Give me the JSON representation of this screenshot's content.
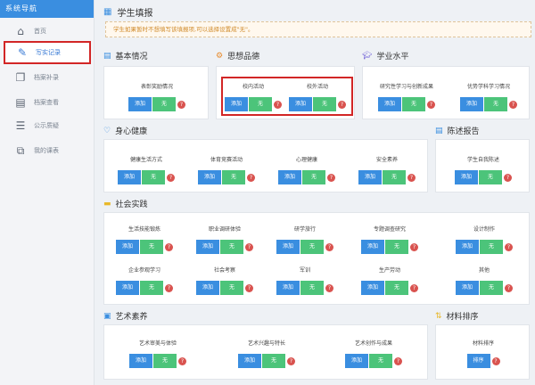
{
  "sidebar": {
    "header": "系统导航",
    "items": [
      {
        "label": "首页",
        "icon": "home-icon"
      },
      {
        "label": "写实记录",
        "icon": "edit-icon"
      },
      {
        "label": "档案补录",
        "icon": "copy-icon"
      },
      {
        "label": "档案查看",
        "icon": "archive-icon"
      },
      {
        "label": "公示质疑",
        "icon": "list-icon"
      },
      {
        "label": "我的课表",
        "icon": "schedule-icon"
      }
    ]
  },
  "page": {
    "title": "学生填报",
    "notice": "学生如果暂时不想填写该填报项,可以选择设置成\"无\"。"
  },
  "buttons": {
    "add": "添加",
    "none": "无",
    "help": "?",
    "sort": "排序"
  },
  "sections": {
    "basic": {
      "title": "基本情况",
      "items": [
        "表彰奖励情况"
      ]
    },
    "morality": {
      "title": "思想品德",
      "items": [
        "校内活动",
        "校外活动"
      ]
    },
    "academic": {
      "title": "学业水平",
      "items": [
        "研究性学习与创新成果",
        "优势学科学习情况"
      ]
    },
    "health": {
      "title": "身心健康",
      "items": [
        "健康生活方式",
        "体育竞赛活动",
        "心理健康",
        "安全素养"
      ]
    },
    "report": {
      "title": "陈述报告",
      "items": [
        "学生自我陈述"
      ]
    },
    "social": {
      "title": "社会实践",
      "items": [
        "生活技能锻炼",
        "职业调研体验",
        "研学旅行",
        "专题调查研究",
        "设计制作",
        "企业参观学习",
        "社会考察",
        "军训",
        "生产劳动",
        "其他"
      ]
    },
    "arts": {
      "title": "艺术素养",
      "items": [
        "艺术审美与体验",
        "艺术兴趣与特长",
        "艺术创作与成果"
      ]
    },
    "materials": {
      "title": "材料排序",
      "items": [
        "材料排序"
      ]
    }
  },
  "colors": {
    "primary": "#3a8ee0",
    "success": "#4cc47a",
    "danger": "#d9534f",
    "highlight": "#d22626"
  }
}
